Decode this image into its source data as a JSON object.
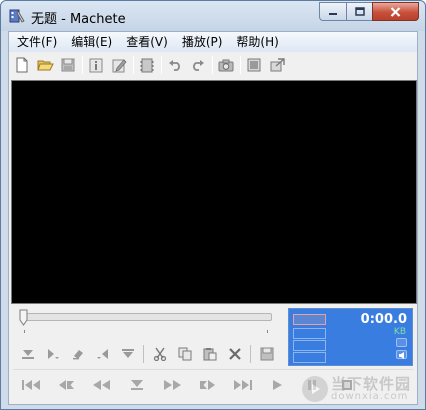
{
  "window": {
    "title": "无题 - Machete",
    "icon": "machete-app-icon"
  },
  "caption_buttons": [
    {
      "name": "minimize-button",
      "icon": "minimize-icon"
    },
    {
      "name": "maximize-button",
      "icon": "maximize-icon"
    },
    {
      "name": "close-button",
      "icon": "close-icon"
    }
  ],
  "menu": {
    "items": [
      "文件(F)",
      "编辑(E)",
      "查看(V)",
      "播放(P)",
      "帮助(H)"
    ]
  },
  "toolbar": {
    "groups": [
      [
        "new-file-icon",
        "open-folder-icon",
        "save-icon"
      ],
      [
        "info-icon",
        "edit-info-icon"
      ],
      [
        "film-icon"
      ],
      [
        "undo-icon",
        "redo-icon"
      ],
      [
        "camera-icon"
      ],
      [
        "frame-icon",
        "frame-export-icon"
      ]
    ]
  },
  "slider": {
    "position": 0
  },
  "edit_buttons": {
    "group1": [
      "mark-in-icon",
      "mark-in-arrow-icon",
      "erase-icon",
      "mark-out-arrow-icon",
      "mark-out-icon"
    ],
    "group2": [
      "cut-icon",
      "copy-icon",
      "paste-icon",
      "delete-icon"
    ],
    "group3": [
      "save-selection-icon"
    ]
  },
  "playback_buttons": [
    "go-start-icon",
    "prev-mark-icon",
    "rewind-icon",
    "stop-icon",
    "fast-forward-icon",
    "next-mark-icon",
    "go-end-icon",
    "play-icon",
    "pause-icon",
    "record-icon"
  ],
  "info_panel": {
    "time": "0:00.0",
    "size_unit": "KB"
  },
  "watermark": {
    "cn": "当下软件园",
    "en": "downxia.com"
  },
  "colors": {
    "titlebar": "#c5d4e6",
    "video_bg": "#000000",
    "info_panel_bg": "#3a7de0",
    "info_time": "#ffffff",
    "info_kb": "#7fe0a0",
    "close_button": "#c8513b"
  }
}
